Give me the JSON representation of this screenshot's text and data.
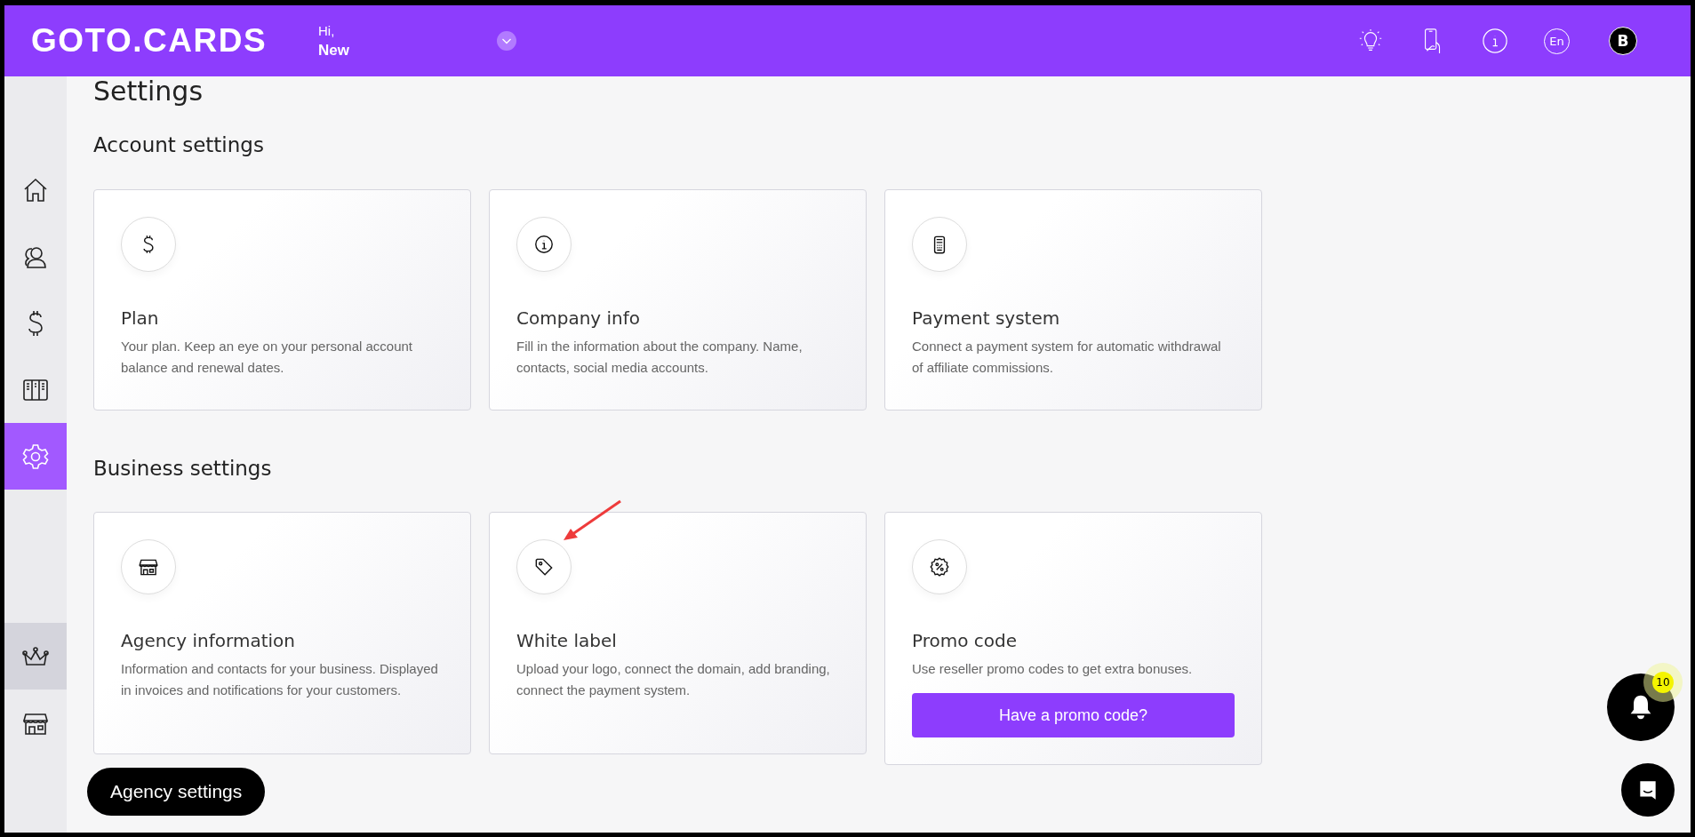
{
  "header": {
    "logo": "GOTO.CARDS",
    "greeting": "Hi,",
    "user_name": "New",
    "language": "En",
    "avatar_letter": "B"
  },
  "sidebar": {
    "items": [
      {
        "kind": "home",
        "selected": false
      },
      {
        "kind": "users",
        "selected": false
      },
      {
        "kind": "dollar",
        "selected": false
      },
      {
        "kind": "columns",
        "selected": false
      },
      {
        "kind": "settings",
        "selected": true
      }
    ],
    "bottom_items": [
      {
        "kind": "crown",
        "highlighted": true
      },
      {
        "kind": "store",
        "highlighted": false
      }
    ]
  },
  "page_title": "Settings",
  "sections": [
    {
      "title": "Account settings",
      "cards": [
        {
          "kind": "dollar",
          "title": "Plan",
          "description": "Your plan. Keep an eye on your personal account balance and renewal dates.",
          "annotated": false
        },
        {
          "kind": "info",
          "title": "Company info",
          "description": "Fill in the information about the company. Name, contacts, social media accounts.",
          "annotated": false
        },
        {
          "kind": "terminal",
          "title": "Payment system",
          "description": "Connect a payment system for automatic withdrawal of affiliate commissions.",
          "annotated": false
        }
      ]
    },
    {
      "title": "Business settings",
      "cards": [
        {
          "kind": "store",
          "title": "Agency information",
          "description": "Information and contacts for your business. Displayed in invoices and notifications for your customers.",
          "annotated": false
        },
        {
          "kind": "tag",
          "title": "White label",
          "description": "Upload your logo, connect the domain, add branding, connect the payment system.",
          "annotated": true
        },
        {
          "kind": "percent",
          "title": "Promo code",
          "description": "Use reseller promo codes to get extra bonuses.",
          "button": "Have a promo code?",
          "annotated": false
        }
      ]
    }
  ],
  "agency_button": "Agency settings",
  "notifications": {
    "count": "10"
  }
}
